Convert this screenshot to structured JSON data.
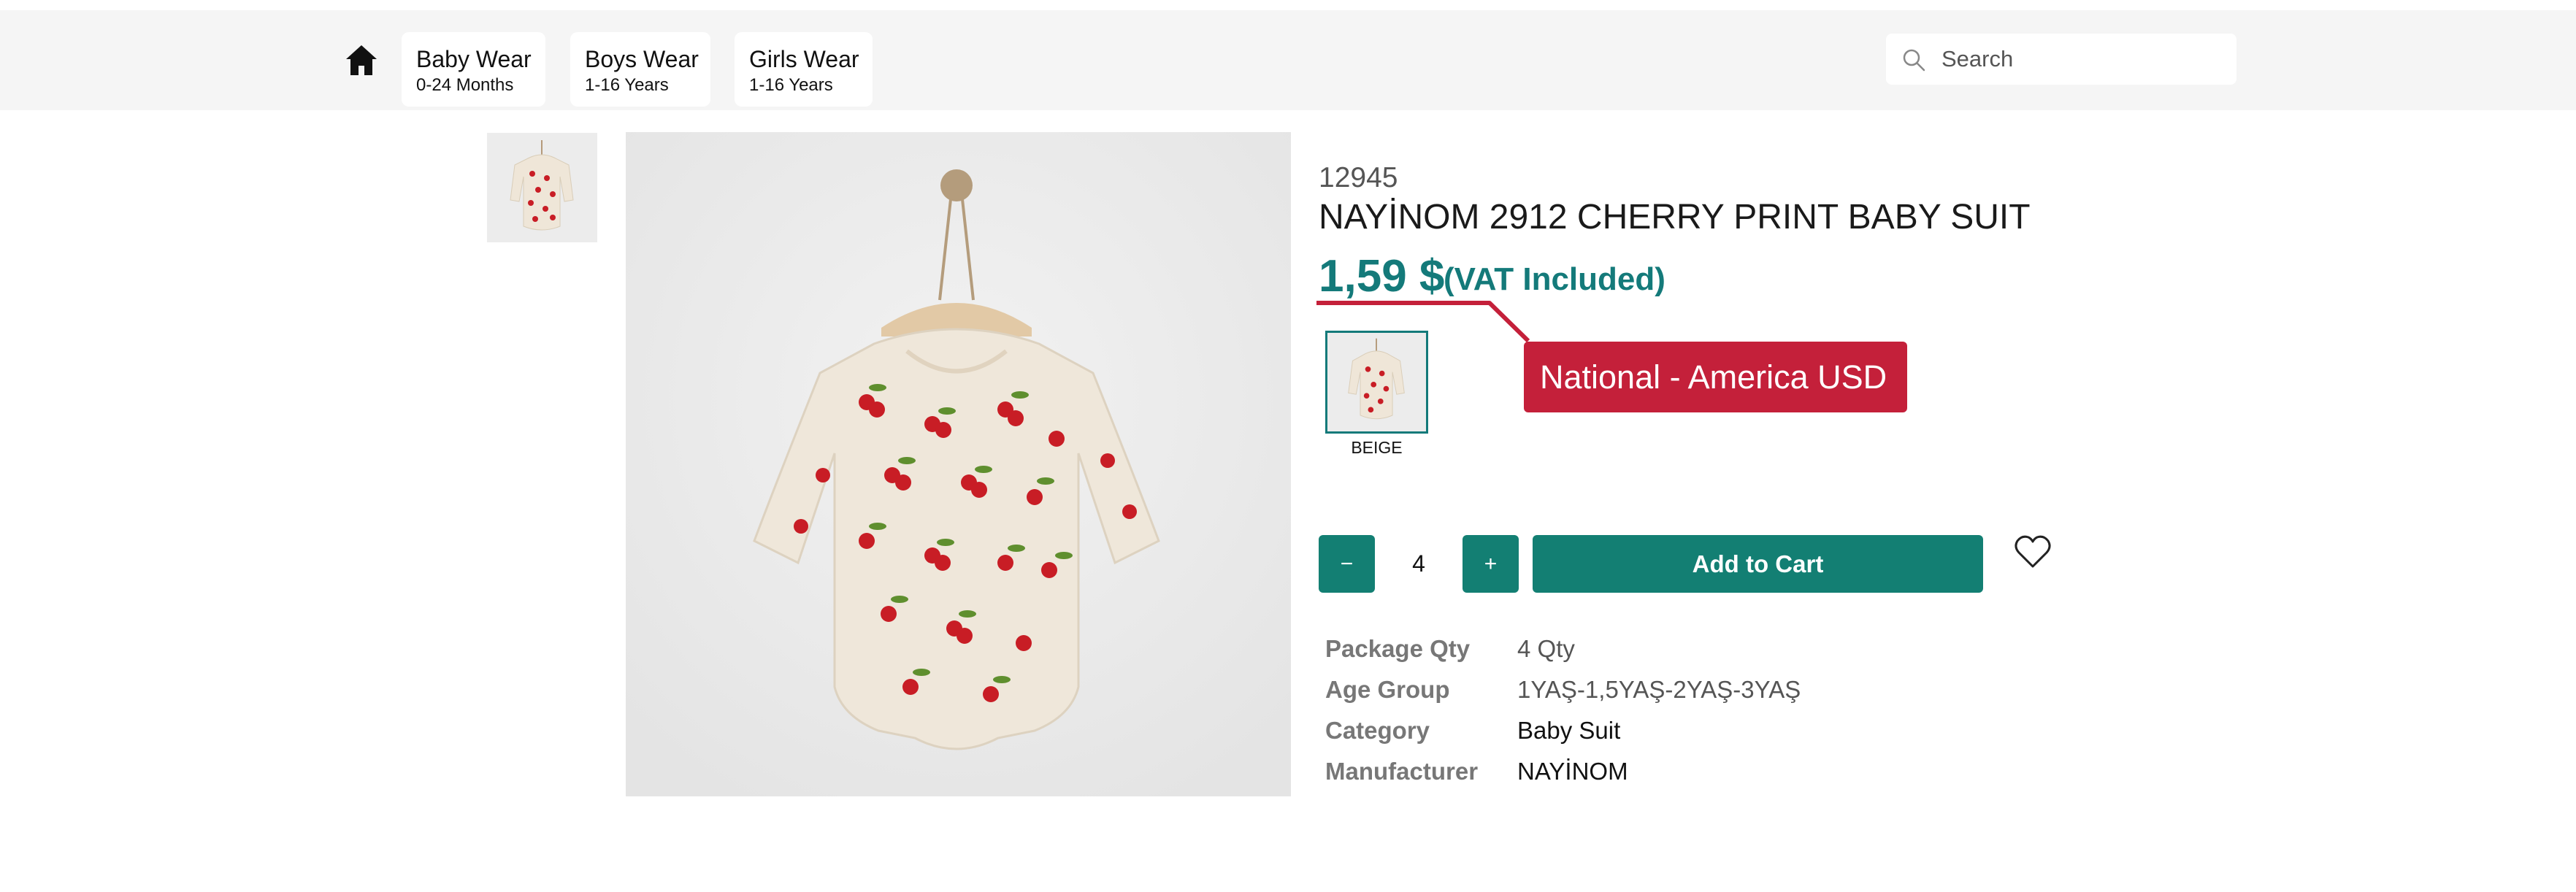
{
  "header": {
    "nav": [
      {
        "title": "Baby Wear",
        "subtitle": "0-24 Months"
      },
      {
        "title": "Boys Wear",
        "subtitle": "1-16 Years"
      },
      {
        "title": "Girls Wear",
        "subtitle": "1-16 Years"
      }
    ],
    "search": {
      "placeholder": "Search",
      "icon": "search-icon"
    },
    "home_icon": "home-icon"
  },
  "product": {
    "sku": "12945",
    "title": "NAYİNOM 2912 CHERRY PRINT BABY SUIT",
    "price": "1,59 $",
    "vat_note": "(VAT Included)",
    "currency_tag": "National - America USD",
    "colors": [
      {
        "label": "BEIGE",
        "selected": true
      }
    ],
    "quantity": "4",
    "minus_label": "−",
    "plus_label": "+",
    "add_to_cart_label": "Add to Cart",
    "specs": [
      {
        "key": "Package Qty",
        "value": "4 Qty"
      },
      {
        "key": "Age Group",
        "value": "1YAŞ-1,5YAŞ-2YAŞ-3YAŞ"
      },
      {
        "key": "Category",
        "value": "Baby Suit"
      },
      {
        "key": "Manufacturer",
        "value": "NAYİNOM"
      }
    ]
  },
  "colors": {
    "accent": "#137f73",
    "price": "#147a7a",
    "tag": "#c4203a",
    "header_bg": "#f5f5f5"
  }
}
